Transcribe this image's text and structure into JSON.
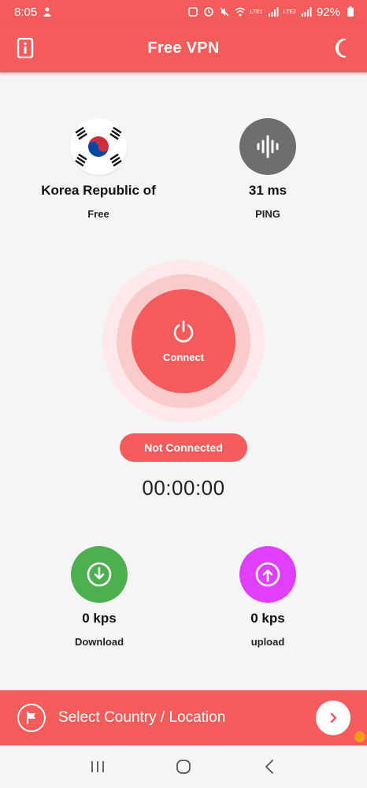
{
  "status_bar": {
    "time": "8:05",
    "battery": "92%",
    "net1": "LTE1",
    "net2": "LTE2"
  },
  "app_bar": {
    "title": "Free VPN"
  },
  "server": {
    "country": "Korea Republic of",
    "tier": "Free",
    "flag_icon": "south-korea-flag-icon"
  },
  "ping": {
    "value": "31 ms",
    "label": "PING",
    "icon": "audio-wave-icon"
  },
  "connect": {
    "label": "Connect",
    "icon": "power-icon",
    "status": "Not Connected",
    "timer": "00:00:00"
  },
  "speeds": {
    "download": {
      "value": "0 kps",
      "label": "Download",
      "color": "#4caf50",
      "icon": "download-arrow-icon"
    },
    "upload": {
      "value": "0 kps",
      "label": "upload",
      "color": "#e040fb",
      "icon": "upload-arrow-icon"
    }
  },
  "bottom": {
    "select_label": "Select Country / Location",
    "flag_icon": "flag-icon",
    "arrow_icon": "chevron-right-icon"
  },
  "colors": {
    "accent": "#f45b5b",
    "ping_gray": "#6e6e6e",
    "ring_light": "#fde9e9",
    "ring_mid": "#fbcaca"
  }
}
